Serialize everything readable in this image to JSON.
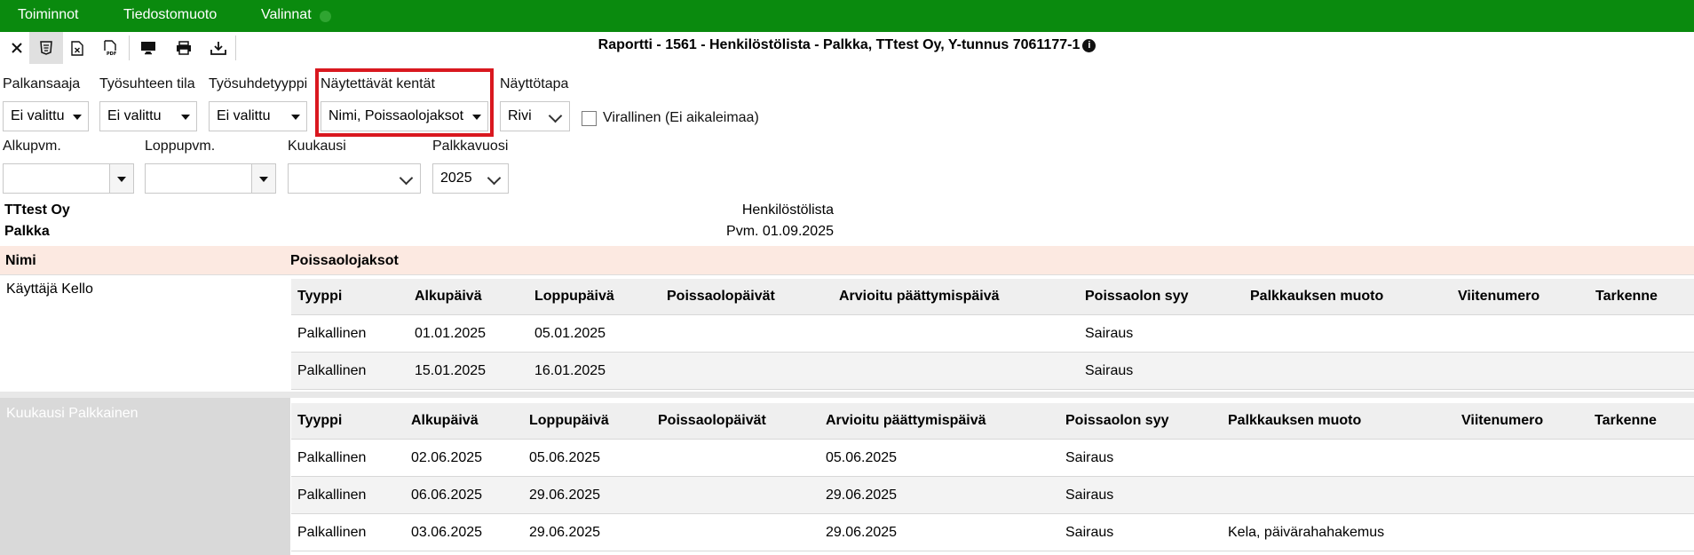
{
  "menu": {
    "items": [
      "Toiminnot",
      "Tiedostomuoto",
      "Valinnat"
    ],
    "status_color": "#2fa531",
    "background": "#0a8a0e"
  },
  "toolbar": {
    "icons": [
      "close-icon",
      "html-icon",
      "excel-icon",
      "pdf-icon",
      "screen-icon",
      "print-icon",
      "download-icon"
    ]
  },
  "report_title": "Raportti - 1561 - Henkilöstölista - Palkka, TTtest Oy, Y-tunnus 7061177-1",
  "filters": {
    "palkansaaja": {
      "label": "Palkansaaja",
      "value": "Ei valittu"
    },
    "tyosuhteen_tila": {
      "label": "Työsuhteen tila",
      "value": "Ei valittu"
    },
    "tyosuhdetyyppi": {
      "label": "Työsuhdetyyppi",
      "value": "Ei valittu"
    },
    "naytettavat_kentat": {
      "label": "Näytettävät kentät",
      "value": "Nimi, Poissaolojaksot"
    },
    "nayttotapa": {
      "label": "Näyttötapa",
      "value": "Rivi"
    },
    "virallinen": {
      "label": "Virallinen (Ei aikaleimaa)",
      "checked": false
    },
    "alkupvm": {
      "label": "Alkupvm.",
      "value": ""
    },
    "loppupvm": {
      "label": "Loppupvm.",
      "value": ""
    },
    "kuukausi": {
      "label": "Kuukausi",
      "value": ""
    },
    "palkkavuosi": {
      "label": "Palkkavuosi",
      "value": "2025"
    }
  },
  "report": {
    "company": "TTtest Oy",
    "subtitle": "Palkka",
    "list_name": "Henkilöstölista",
    "date": "Pvm. 01.09.2025",
    "col_name": "Nimi",
    "col_absences": "Poissaolojaksot",
    "header_band_color": "#fce9e1",
    "inner_headers": [
      "Tyyppi",
      "Alkupäivä",
      "Loppupäivä",
      "Poissaolopäivät",
      "Arvioitu päättymispäivä",
      "Poissaolon syy",
      "Palkkauksen muoto",
      "Viitenumero",
      "Tarkenne"
    ],
    "employees": [
      {
        "name": "Käyttäjä Kello",
        "rows": [
          [
            "Palkallinen",
            "01.01.2025",
            "05.01.2025",
            "",
            "",
            "Sairaus",
            "",
            "",
            ""
          ],
          [
            "Palkallinen",
            "15.01.2025",
            "16.01.2025",
            "",
            "",
            "Sairaus",
            "",
            "",
            ""
          ]
        ]
      },
      {
        "name": "Kuukausi Palkkainen",
        "rows": [
          [
            "Palkallinen",
            "02.06.2025",
            "05.06.2025",
            "",
            "05.06.2025",
            "Sairaus",
            "",
            "",
            ""
          ],
          [
            "Palkallinen",
            "06.06.2025",
            "29.06.2025",
            "",
            "29.06.2025",
            "Sairaus",
            "",
            "",
            ""
          ],
          [
            "Palkallinen",
            "03.06.2025",
            "29.06.2025",
            "",
            "29.06.2025",
            "Sairaus",
            "Kela, päivärahahakemus",
            "",
            ""
          ]
        ]
      }
    ]
  }
}
